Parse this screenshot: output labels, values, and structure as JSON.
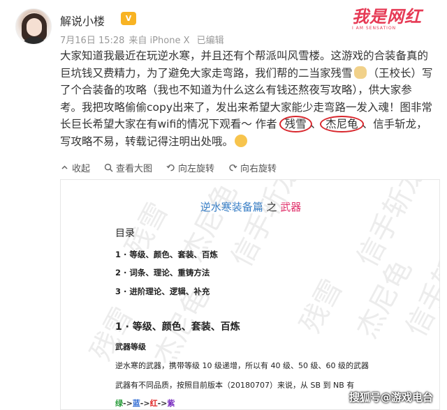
{
  "header": {
    "username": "解说小楼",
    "vip_badge": "V",
    "date": "7月16日 15:28",
    "source": "来自 iPhone X",
    "edited": "已编辑"
  },
  "watermark": {
    "main": "我是网红",
    "sub": "I AM SENSATION"
  },
  "post": {
    "p1": "大家知道我最近在玩逆水寒，并且还有个帮派叫风雪楼。这游戏的合装备真的巨坑钱又费精力，为了避免大家走弯路，我们帮的二当家残雪",
    "p1b": "（王校长）写了个合装备的攻略（我也不知道为什么这么有钱还熬夜写攻略），供大家参考。我把攻略偷偷copy出来了，发出来希望大家能少走弯路一发入魂！图非常长巨长希望大家在有wifi的情况下观看～ 作者",
    "author1": "残雪",
    "sep": "、",
    "author2": "杰尼龟",
    "p2": "、信手斩龙，写攻略不易，转载记得注明出处哦。"
  },
  "actions": {
    "collapse": "收起",
    "view_large": "查看大图",
    "rotate_left": "向左旋转",
    "rotate_right": "向右旋转"
  },
  "doc": {
    "title_main": "逆水寒装备篇",
    "title_of": "之",
    "title_weapon": "武器",
    "toc_head": "目录",
    "toc": [
      "1 · 等级、颜色、套装、百炼",
      "2 · 词条、理论、重铸方法",
      "3 · 进阶理论、逻辑、补充"
    ],
    "section1": "1 · 等级、颜色、套装、百炼",
    "subhead": "武器等级",
    "para1": "逆水寒的武器，携带等级 10 级递增，所以有 40 级、50 级、60 级的武器",
    "para2": "武器有不同品质，按照目前版本（20180707）来说，从 SB 到 NB 有",
    "tags": [
      "绿",
      "蓝",
      "红",
      "紫"
    ],
    "tag_arrow": "->",
    "watermark_text": [
      "残雪",
      "杰尼龟",
      "信手斩龙"
    ]
  },
  "source_mark": "搜狐号@游戏电台"
}
